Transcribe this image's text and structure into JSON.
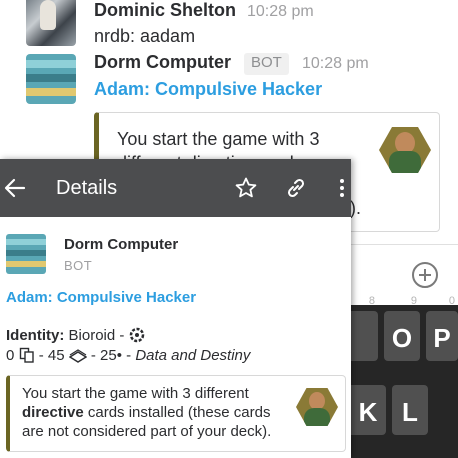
{
  "chat": {
    "messages": [
      {
        "author": "Dominic Shelton",
        "time": "10:28 pm",
        "text": "nrdb: aadam"
      },
      {
        "author": "Dorm Computer",
        "badge": "BOT",
        "time": "10:28 pm",
        "link": "Adam: Compulsive Hacker"
      }
    ],
    "attachment": {
      "line1": "You start the game with 3",
      "line2": "different directive cards",
      "tail": ")."
    }
  },
  "keyboard": {
    "keys": [
      {
        "label": "",
        "hint": "8"
      },
      {
        "label": "O",
        "hint": "9"
      },
      {
        "label": "P",
        "hint": "0"
      },
      {
        "label": "",
        "hint": ""
      },
      {
        "label": "K",
        "hint": ""
      },
      {
        "label": "L",
        "hint": ""
      }
    ]
  },
  "details": {
    "title": "Details",
    "author": "Dorm Computer",
    "badge": "BOT",
    "link": "Adam: Compulsive Hacker",
    "identity_label": "Identity:",
    "identity_value": "Bioroid -",
    "stats": {
      "deck": "0",
      "influence": "- 45",
      "link": "- 25• -",
      "set": "Data and Destiny"
    },
    "attachment": {
      "text_before": "You start the game with 3 different ",
      "text_bold": "directive",
      "text_after": " cards installed (these cards are not considered part of your deck)."
    }
  },
  "colors": {
    "header": "#4c4d4f",
    "link": "#2d9ee0",
    "attachment_border": "#6b6523",
    "keyboard": "#262626"
  }
}
